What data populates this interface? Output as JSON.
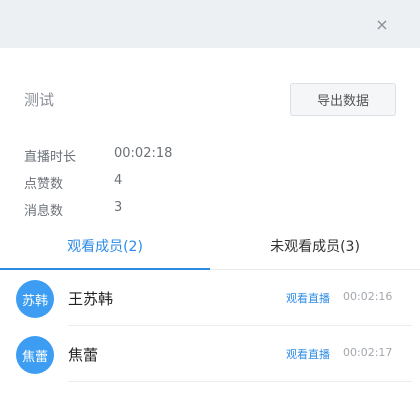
{
  "header": {
    "close_icon": "×"
  },
  "title": "测试",
  "export_label": "导出数据",
  "stats": [
    {
      "label": "直播时长",
      "value": "00:02:18"
    },
    {
      "label": "点赞数",
      "value": "4"
    },
    {
      "label": "消息数",
      "value": "3"
    }
  ],
  "tabs": [
    {
      "label": "观看成员(2)"
    },
    {
      "label": "未观看成员(3)"
    }
  ],
  "members": [
    {
      "avatar": "苏韩",
      "name": "王苏韩",
      "action": "观看直播",
      "time": "00:02:16"
    },
    {
      "avatar": "焦蕾",
      "name": "焦蕾",
      "action": "观看直播",
      "time": "00:02:17"
    }
  ],
  "colors": {
    "accent": "#2d8be6",
    "avatar_bg": "#3d9df2",
    "topbar": "#edf0f3"
  }
}
